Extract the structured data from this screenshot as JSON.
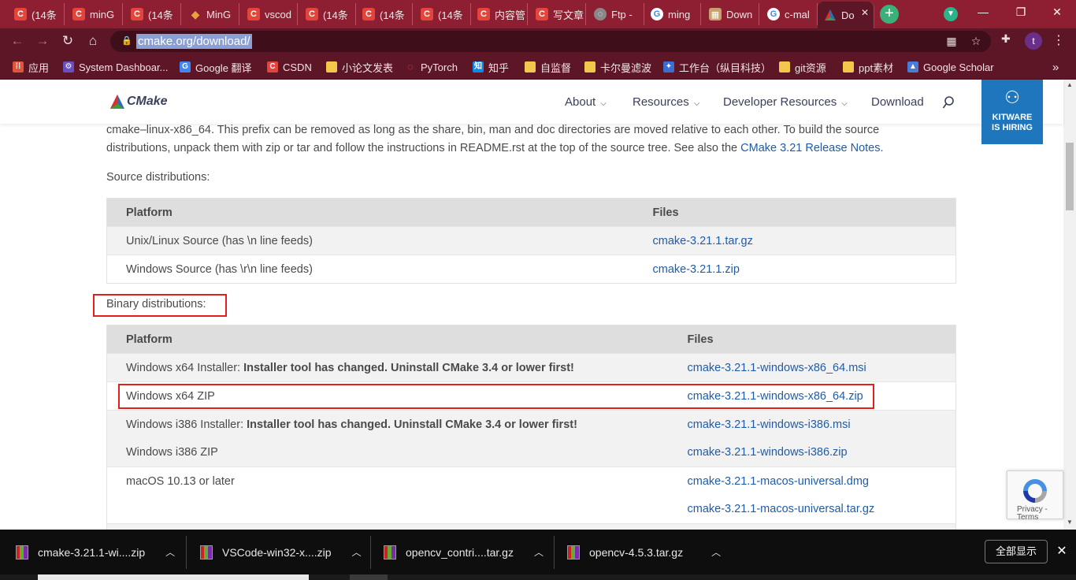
{
  "tabs": [
    {
      "label": "(14条",
      "icon": "csdn-icon",
      "color": "#e4443a"
    },
    {
      "label": "minG",
      "icon": "csdn-icon",
      "color": "#e4443a"
    },
    {
      "label": "(14条",
      "icon": "csdn-icon",
      "color": "#e4443a"
    },
    {
      "label": "MinG",
      "icon": "diamond-icon",
      "color": "#e8a23c"
    },
    {
      "label": "vscod",
      "icon": "csdn-icon",
      "color": "#e4443a"
    },
    {
      "label": "(14条",
      "icon": "csdn-icon",
      "color": "#e4443a"
    },
    {
      "label": "(14条",
      "icon": "csdn-icon",
      "color": "#e4443a"
    },
    {
      "label": "(14条",
      "icon": "csdn-icon",
      "color": "#e4443a"
    },
    {
      "label": "内容管",
      "icon": "csdn-icon",
      "color": "#e4443a"
    },
    {
      "label": "写文章",
      "icon": "csdn-icon",
      "color": "#e4443a"
    },
    {
      "label": "Ftp -",
      "icon": "globe-icon",
      "color": "#888888"
    },
    {
      "label": "ming",
      "icon": "google-icon",
      "color": "#4285f4"
    },
    {
      "label": "Down",
      "icon": "image-icon",
      "color": "#c8a070"
    },
    {
      "label": "c-mal",
      "icon": "google-icon",
      "color": "#4285f4"
    },
    {
      "label": "Do",
      "icon": "cmake-icon",
      "color": "#2a6fb5"
    }
  ],
  "toolbar": {
    "url": "cmake.org/download/"
  },
  "bookmarks": [
    {
      "label": "应用",
      "icon": "apps-grid-icon",
      "color": "#e0543c"
    },
    {
      "label": "System Dashboar...",
      "icon": "dashboard-icon",
      "color": "#6a4fbf"
    },
    {
      "label": "Google 翻译",
      "icon": "translate-icon",
      "color": "#4285f4"
    },
    {
      "label": "CSDN",
      "icon": "csdn-icon",
      "color": "#e4443a"
    },
    {
      "label": "小论文发表",
      "icon": "folder-icon",
      "color": "#f2c74c"
    },
    {
      "label": "PyTorch",
      "icon": "pytorch-icon",
      "color": "#ee4c2c"
    },
    {
      "label": "知乎",
      "icon": "zhihu-icon",
      "color": "#0f88eb"
    },
    {
      "label": "自监督",
      "icon": "folder-icon",
      "color": "#f2c74c"
    },
    {
      "label": "卡尔曼滤波",
      "icon": "folder-icon",
      "color": "#f2c74c"
    },
    {
      "label": "工作台（纵目科技）",
      "icon": "workbench-icon",
      "color": "#3a6fd1"
    },
    {
      "label": "git资源",
      "icon": "folder-icon",
      "color": "#f2c74c"
    },
    {
      "label": "ppt素材",
      "icon": "folder-icon",
      "color": "#f2c74c"
    },
    {
      "label": "Google Scholar",
      "icon": "scholar-icon",
      "color": "#4a7bd6"
    }
  ],
  "site": {
    "logo": "CMake",
    "nav": [
      "About",
      "Resources",
      "Developer Resources",
      "Download"
    ],
    "hiring_line1": "KITWARE",
    "hiring_line2": "IS HIRING"
  },
  "intro": {
    "text": "cmake–linux-x86_64. This prefix can be removed as long as the share, bin, man and doc directories are moved relative to each other. To build the source distributions, unpack them with zip or tar and follow the instructions in README.rst at the top of the source tree. See also the ",
    "link": "CMake 3.21 Release Notes",
    "tail": "."
  },
  "source_distributions": {
    "label": "Source distributions:",
    "headers": [
      "Platform",
      "Files"
    ],
    "rows": [
      {
        "platform": "Unix/Linux Source (has \\n line feeds)",
        "file": "cmake-3.21.1.tar.gz"
      },
      {
        "platform": "Windows Source (has \\r\\n line feeds)",
        "file": "cmake-3.21.1.zip"
      }
    ]
  },
  "binary_distributions": {
    "label": "Binary distributions:",
    "headers": [
      "Platform",
      "Files"
    ],
    "rows": [
      {
        "platform": "Windows x64 Installer: ",
        "note": "Installer tool has changed. Uninstall CMake 3.4 or lower first!",
        "file": "cmake-3.21.1-windows-x86_64.msi"
      },
      {
        "platform": "Windows x64 ZIP",
        "note": "",
        "file": "cmake-3.21.1-windows-x86_64.zip"
      },
      {
        "platform": "Windows i386 Installer: ",
        "note": "Installer tool has changed. Uninstall CMake 3.4 or lower first!",
        "file": "cmake-3.21.1-windows-i386.msi"
      },
      {
        "platform": "Windows i386 ZIP",
        "note": "",
        "file": "cmake-3.21.1-windows-i386.zip"
      },
      {
        "platform": "macOS 10.13 or later",
        "note": "",
        "file": "cmake-3.21.1-macos-universal.dmg"
      },
      {
        "platform": "",
        "note": "",
        "file": "cmake-3.21.1-macos-universal.tar.gz"
      }
    ]
  },
  "recaptcha": {
    "text": "Privacy - Terms"
  },
  "downloads": [
    {
      "name": "cmake-3.21.1-wi....zip"
    },
    {
      "name": "VSCode-win32-x....zip"
    },
    {
      "name": "opencv_contri....tar.gz"
    },
    {
      "name": "opencv-4.5.3.tar.gz"
    }
  ],
  "shelf": {
    "show_all": "全部显示"
  },
  "colors": {
    "browser_frame": "#8e1f32",
    "toolbar": "#5c1626",
    "link": "#1f5ca8",
    "highlight_box": "#e0201f",
    "hiring_banner": "#1e76bc"
  }
}
